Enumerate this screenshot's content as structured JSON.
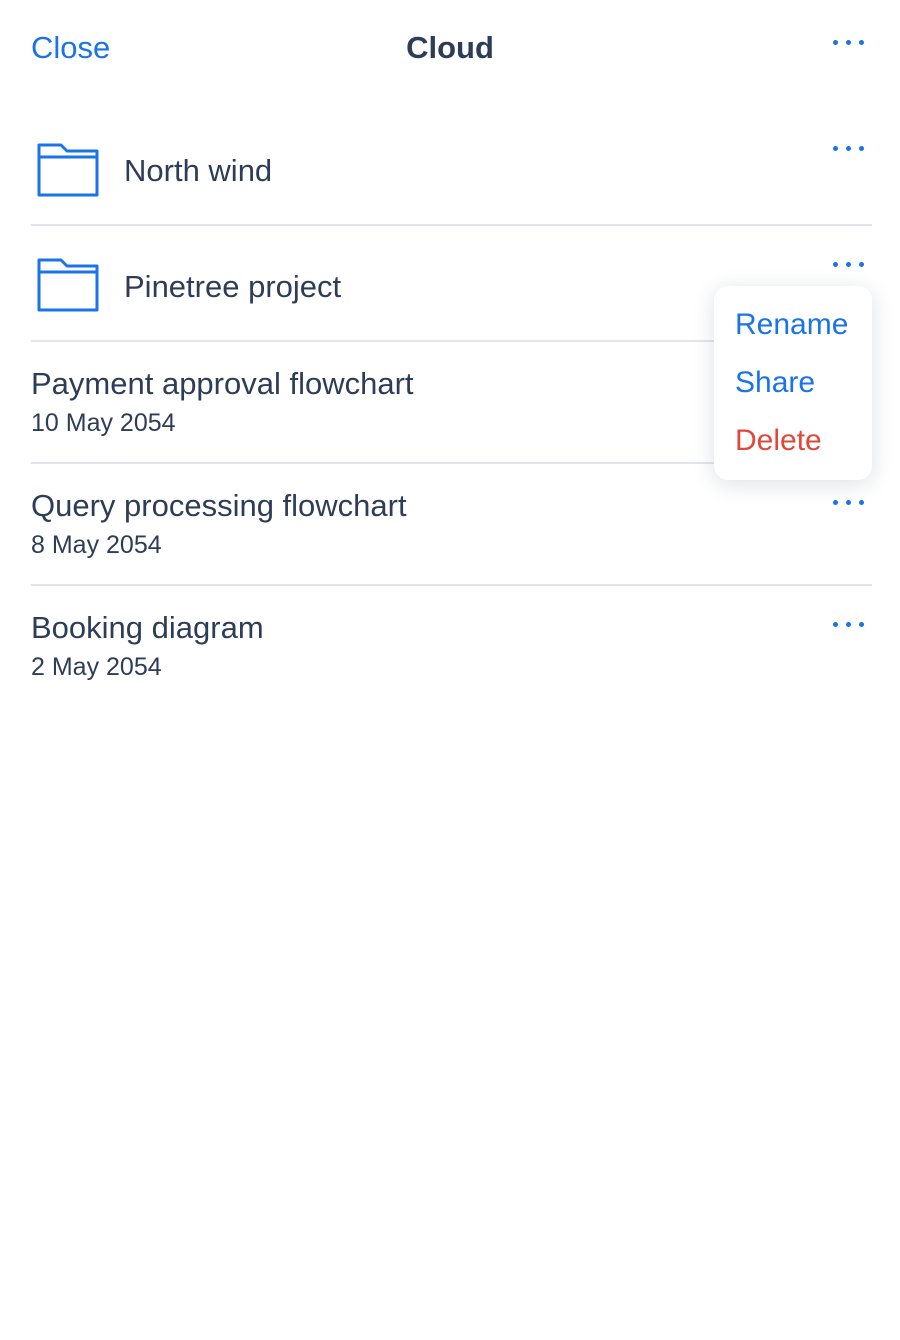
{
  "header": {
    "close_label": "Close",
    "title": "Cloud"
  },
  "folders": [
    {
      "name": "North wind"
    },
    {
      "name": "Pinetree project"
    }
  ],
  "files": [
    {
      "name": "Payment approval flowchart",
      "date": "10 May 2054"
    },
    {
      "name": "Query processing flowchart",
      "date": "8 May 2054"
    },
    {
      "name": "Booking diagram",
      "date": "2 May 2054"
    }
  ],
  "context_menu": {
    "items": [
      {
        "label": "Rename",
        "color": "#1a73e8"
      },
      {
        "label": "Share",
        "color": "#1a73e8"
      },
      {
        "label": "Delete",
        "color": "#e0483a"
      }
    ]
  },
  "icons": {
    "folder": "folder-icon",
    "more": "more-dots-icon"
  },
  "colors": {
    "accent": "#1a73e8",
    "text": "#2e3d57",
    "destructive": "#e0483a",
    "divider": "#e3e5e8"
  }
}
